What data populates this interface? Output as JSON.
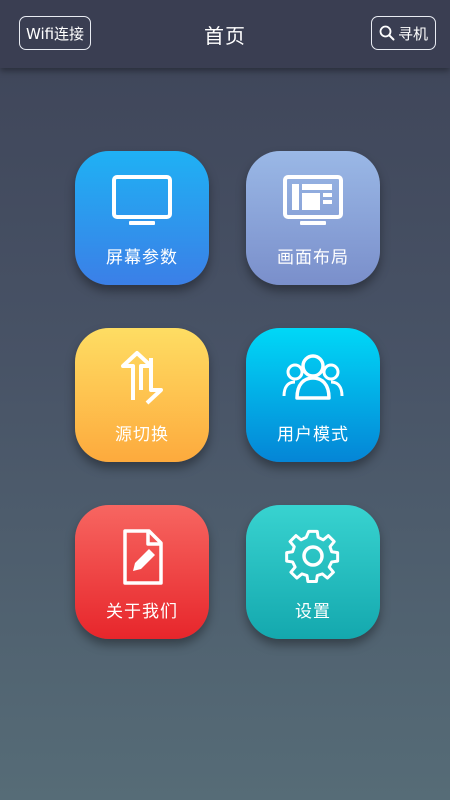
{
  "header": {
    "wifi_label": "Wifi连接",
    "title": "首页",
    "search_label": "寻机"
  },
  "tiles": [
    {
      "label": "屏幕参数",
      "icon": "monitor-icon",
      "color": "#2b98ee"
    },
    {
      "label": "画面布局",
      "icon": "layout-screen-icon",
      "color": "#8aa3d8"
    },
    {
      "label": "源切换",
      "icon": "swap-arrows-icon",
      "color": "#fec64f"
    },
    {
      "label": "用户模式",
      "icon": "user-group-icon",
      "color": "#02aee6"
    },
    {
      "label": "关于我们",
      "icon": "document-edit-icon",
      "color": "#ef4145"
    },
    {
      "label": "设置",
      "icon": "gear-icon",
      "color": "#26bdbf"
    }
  ]
}
